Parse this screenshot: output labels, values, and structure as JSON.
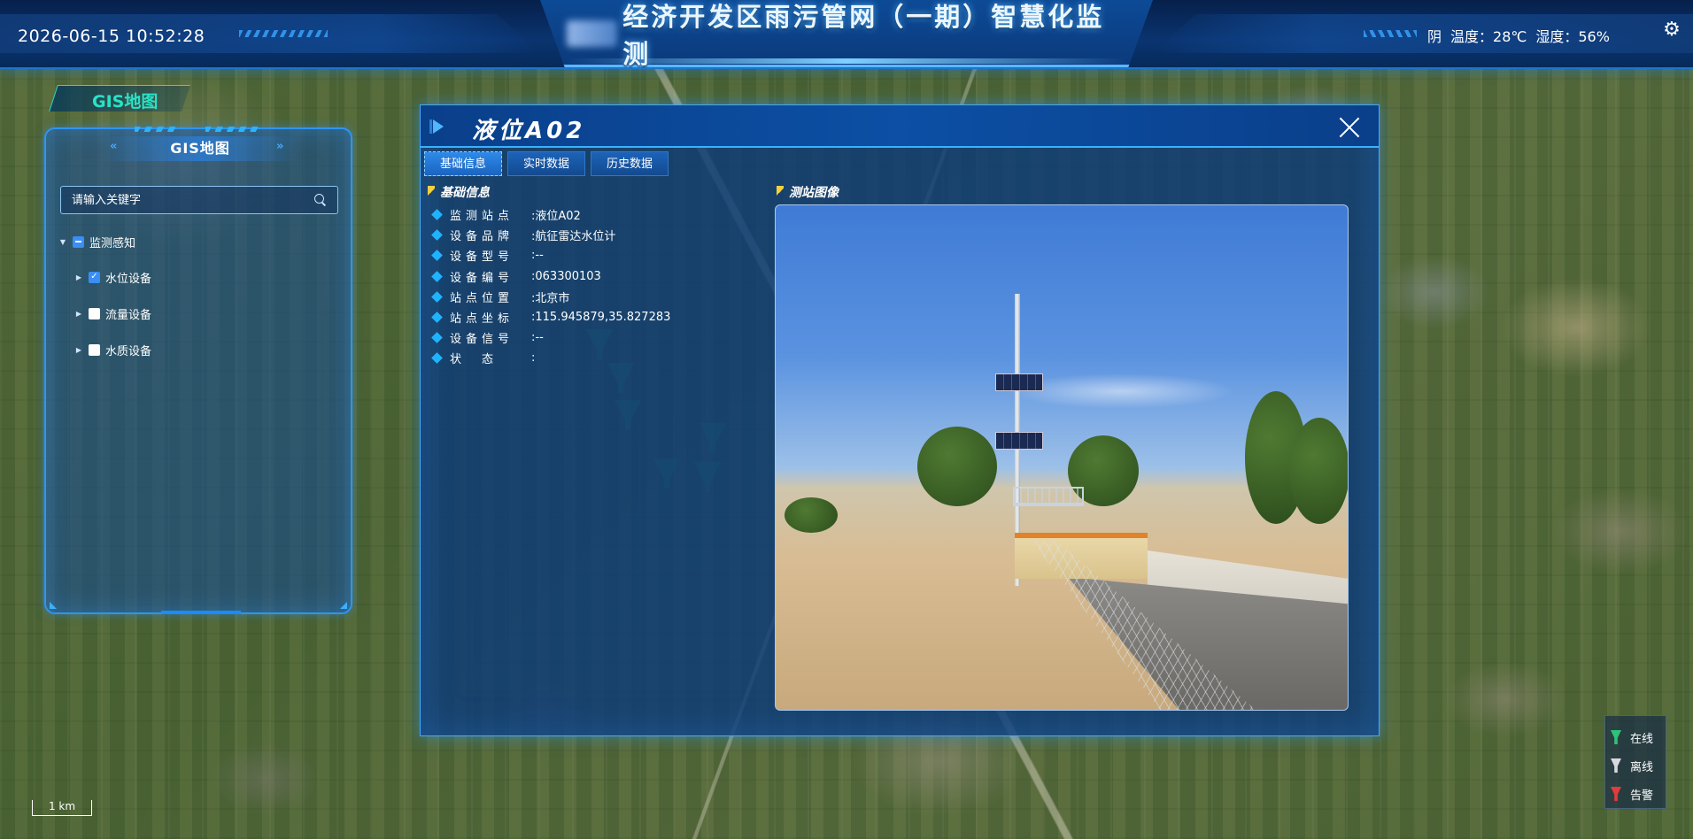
{
  "header": {
    "datetime": "2026-06-15 10:52:28",
    "title": "经济开发区雨污管网（一期）智慧化监测",
    "weather": {
      "condition": "阴",
      "temperature": "温度：28℃",
      "humidity": "湿度：56%"
    },
    "settings_icon": "gear-icon"
  },
  "gis_tab": {
    "label": "GIS地图"
  },
  "gis_panel": {
    "title": "GIS地图",
    "search": {
      "placeholder": "请输入关键字",
      "value": ""
    },
    "tree": {
      "root": {
        "label": "监测感知",
        "state": "partial",
        "expanded": true
      },
      "children": [
        {
          "label": "水位设备",
          "checked": true
        },
        {
          "label": "流量设备",
          "checked": false
        },
        {
          "label": "水质设备",
          "checked": false
        }
      ]
    }
  },
  "dialog": {
    "title": "液位A02",
    "tabs": [
      {
        "label": "基础信息",
        "active": true
      },
      {
        "label": "实时数据",
        "active": false
      },
      {
        "label": "历史数据",
        "active": false
      }
    ],
    "basic_info": {
      "section_title": "基础信息",
      "rows": [
        {
          "label": "监测站点",
          "value": ":液位A02"
        },
        {
          "label": "设备品牌",
          "value": ":航征雷达水位计"
        },
        {
          "label": "设备型号",
          "value": ":--"
        },
        {
          "label": "设备编号",
          "value": ":063300103"
        },
        {
          "label": "站点位置",
          "value": ":北京市"
        },
        {
          "label": "站点坐标",
          "value": ":115.945879,35.827283"
        },
        {
          "label": "设备信号",
          "value": ":--"
        },
        {
          "label": "状　态",
          "value": ":"
        }
      ]
    },
    "photo": {
      "section_title": "测站图像"
    }
  },
  "legend": [
    {
      "label": "在线",
      "color": "#2fc27a"
    },
    {
      "label": "离线",
      "color": "#d7d9de"
    },
    {
      "label": "告警",
      "color": "#e23b3b"
    }
  ],
  "map": {
    "scale_label": "1 km"
  }
}
